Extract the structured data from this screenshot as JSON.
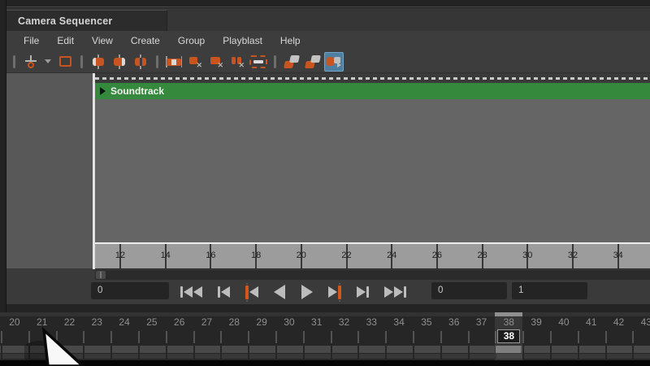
{
  "window": {
    "tab_title": "Camera Sequencer"
  },
  "menu": {
    "items": [
      "File",
      "Edit",
      "View",
      "Create",
      "Group",
      "Playblast",
      "Help"
    ]
  },
  "toolbar": {
    "icons": [
      "move-tool-icon",
      "tool-dropdown-caret-icon",
      "marquee-select-icon",
      "clip-trim-start-icon",
      "clip-trim-end-icon",
      "clip-split-icon",
      "clip-extend-icon",
      "clip-cut-icon",
      "clip-copy-icon",
      "clip-paste-icon",
      "ripple-edit-icon",
      "group-shots-icon",
      "ungroup-shots-icon",
      "playblast-shot-icon"
    ],
    "active_icon": "playblast-shot-icon"
  },
  "sequencer": {
    "soundtrack_label": "Soundtrack",
    "ruler_ticks": [
      12,
      14,
      16,
      18,
      20,
      22,
      24,
      26,
      28,
      30,
      32,
      34
    ]
  },
  "playback": {
    "current_time_value": "0",
    "range_start_value": "0",
    "range_end_value": "1",
    "buttons": [
      "go-to-start-icon",
      "step-back-frame-icon",
      "step-back-key-icon",
      "play-backwards-icon",
      "play-forwards-icon",
      "step-forward-key-icon",
      "step-forward-frame-icon",
      "go-to-end-icon"
    ]
  },
  "time_slider": {
    "frames": [
      20,
      21,
      22,
      23,
      24,
      25,
      26,
      27,
      28,
      29,
      30,
      31,
      32,
      33,
      34,
      35,
      36,
      37,
      38,
      39,
      40,
      41,
      42,
      43
    ],
    "current_frame": 38,
    "current_frame_label": "38"
  },
  "colors": {
    "accent_orange": "#c8551f",
    "soundtrack_green": "#35893c",
    "active_tool_blue": "#4e7fa0",
    "ruler_gray": "#9c9c9c"
  }
}
